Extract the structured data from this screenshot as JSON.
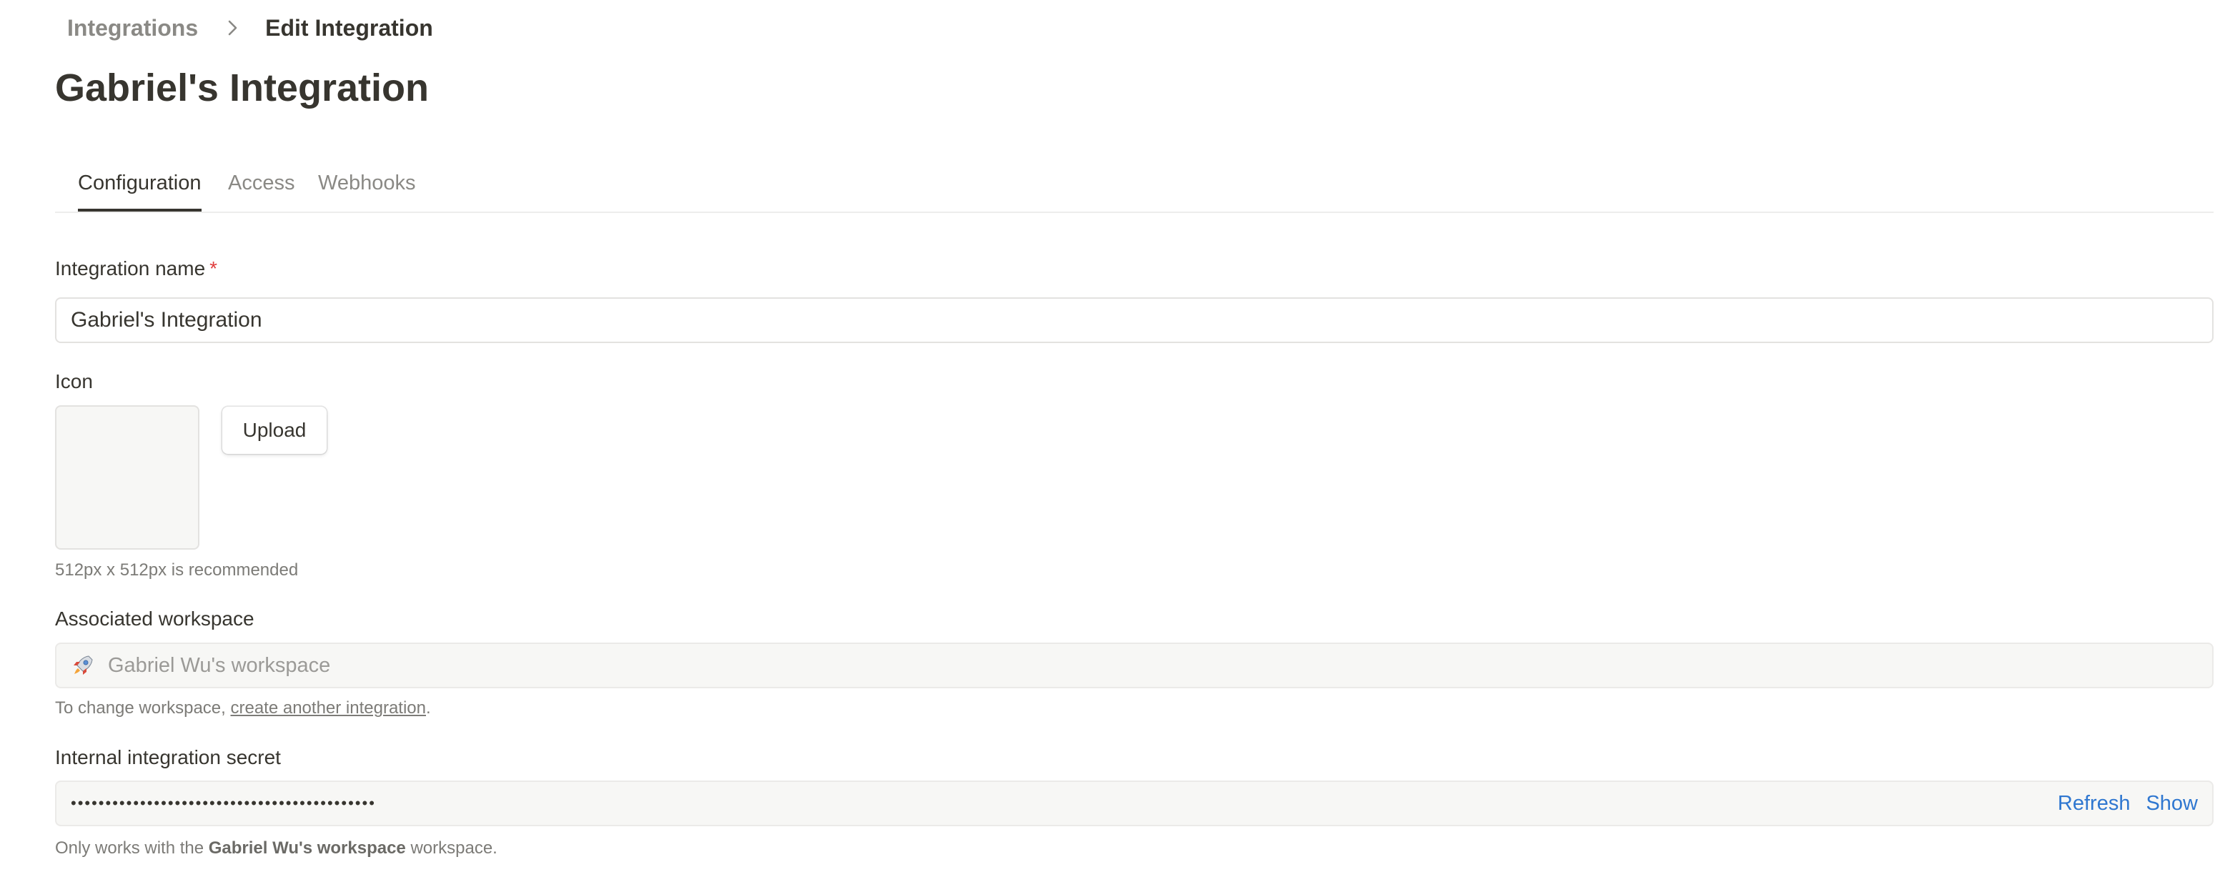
{
  "breadcrumb": {
    "root": "Integrations",
    "current": "Edit Integration"
  },
  "page": {
    "title": "Gabriel's Integration"
  },
  "tabs": [
    {
      "label": "Configuration",
      "active": true
    },
    {
      "label": "Access",
      "active": false
    },
    {
      "label": "Webhooks",
      "active": false
    }
  ],
  "form": {
    "integration_name": {
      "label": "Integration name",
      "required_mark": "*",
      "value": "Gabriel's Integration"
    },
    "icon": {
      "label": "Icon",
      "upload_label": "Upload",
      "hint": "512px x 512px is recommended"
    },
    "workspace": {
      "label": "Associated workspace",
      "icon": "rocket-icon",
      "value": "Gabriel Wu's workspace",
      "hint_prefix": "To change workspace, ",
      "hint_link": "create another integration",
      "hint_suffix": "."
    },
    "secret": {
      "label": "Internal integration secret",
      "masked_value": "••••••••••••••••••••••••••••••••••••••••••••",
      "refresh_label": "Refresh",
      "show_label": "Show",
      "hint_prefix": "Only works with the ",
      "hint_bold": "Gabriel Wu's workspace",
      "hint_suffix": " workspace."
    }
  },
  "colors": {
    "text": "#37352f",
    "muted": "#8a8985",
    "accent": "#2f77d0",
    "required": "#e03e3e",
    "field_bg": "#f7f7f5"
  }
}
